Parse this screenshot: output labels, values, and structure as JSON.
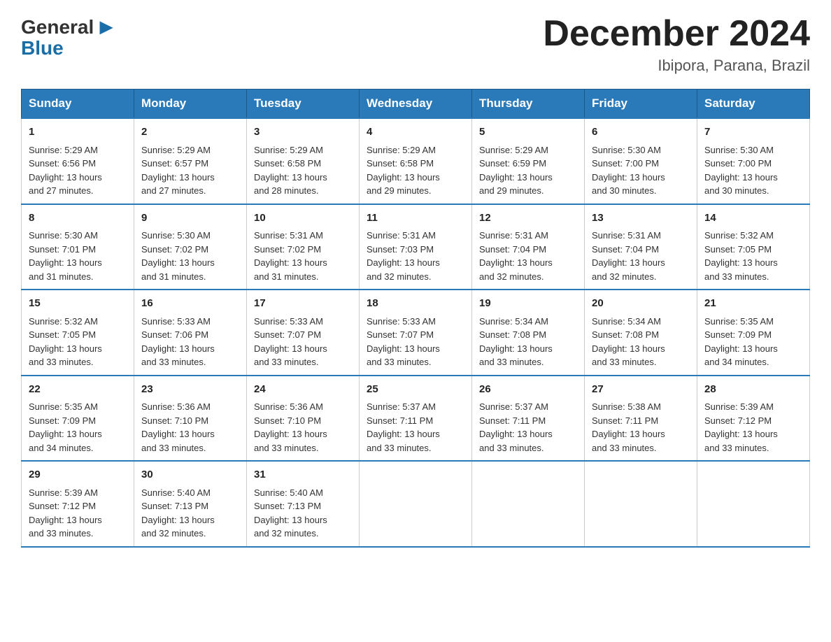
{
  "header": {
    "logo": {
      "general": "General",
      "blue": "Blue"
    },
    "title": "December 2024",
    "location": "Ibipora, Parana, Brazil"
  },
  "days_of_week": [
    "Sunday",
    "Monday",
    "Tuesday",
    "Wednesday",
    "Thursday",
    "Friday",
    "Saturday"
  ],
  "weeks": [
    [
      {
        "day": "1",
        "sunrise": "5:29 AM",
        "sunset": "6:56 PM",
        "daylight": "13 hours and 27 minutes."
      },
      {
        "day": "2",
        "sunrise": "5:29 AM",
        "sunset": "6:57 PM",
        "daylight": "13 hours and 27 minutes."
      },
      {
        "day": "3",
        "sunrise": "5:29 AM",
        "sunset": "6:58 PM",
        "daylight": "13 hours and 28 minutes."
      },
      {
        "day": "4",
        "sunrise": "5:29 AM",
        "sunset": "6:58 PM",
        "daylight": "13 hours and 29 minutes."
      },
      {
        "day": "5",
        "sunrise": "5:29 AM",
        "sunset": "6:59 PM",
        "daylight": "13 hours and 29 minutes."
      },
      {
        "day": "6",
        "sunrise": "5:30 AM",
        "sunset": "7:00 PM",
        "daylight": "13 hours and 30 minutes."
      },
      {
        "day": "7",
        "sunrise": "5:30 AM",
        "sunset": "7:00 PM",
        "daylight": "13 hours and 30 minutes."
      }
    ],
    [
      {
        "day": "8",
        "sunrise": "5:30 AM",
        "sunset": "7:01 PM",
        "daylight": "13 hours and 31 minutes."
      },
      {
        "day": "9",
        "sunrise": "5:30 AM",
        "sunset": "7:02 PM",
        "daylight": "13 hours and 31 minutes."
      },
      {
        "day": "10",
        "sunrise": "5:31 AM",
        "sunset": "7:02 PM",
        "daylight": "13 hours and 31 minutes."
      },
      {
        "day": "11",
        "sunrise": "5:31 AM",
        "sunset": "7:03 PM",
        "daylight": "13 hours and 32 minutes."
      },
      {
        "day": "12",
        "sunrise": "5:31 AM",
        "sunset": "7:04 PM",
        "daylight": "13 hours and 32 minutes."
      },
      {
        "day": "13",
        "sunrise": "5:31 AM",
        "sunset": "7:04 PM",
        "daylight": "13 hours and 32 minutes."
      },
      {
        "day": "14",
        "sunrise": "5:32 AM",
        "sunset": "7:05 PM",
        "daylight": "13 hours and 33 minutes."
      }
    ],
    [
      {
        "day": "15",
        "sunrise": "5:32 AM",
        "sunset": "7:05 PM",
        "daylight": "13 hours and 33 minutes."
      },
      {
        "day": "16",
        "sunrise": "5:33 AM",
        "sunset": "7:06 PM",
        "daylight": "13 hours and 33 minutes."
      },
      {
        "day": "17",
        "sunrise": "5:33 AM",
        "sunset": "7:07 PM",
        "daylight": "13 hours and 33 minutes."
      },
      {
        "day": "18",
        "sunrise": "5:33 AM",
        "sunset": "7:07 PM",
        "daylight": "13 hours and 33 minutes."
      },
      {
        "day": "19",
        "sunrise": "5:34 AM",
        "sunset": "7:08 PM",
        "daylight": "13 hours and 33 minutes."
      },
      {
        "day": "20",
        "sunrise": "5:34 AM",
        "sunset": "7:08 PM",
        "daylight": "13 hours and 33 minutes."
      },
      {
        "day": "21",
        "sunrise": "5:35 AM",
        "sunset": "7:09 PM",
        "daylight": "13 hours and 34 minutes."
      }
    ],
    [
      {
        "day": "22",
        "sunrise": "5:35 AM",
        "sunset": "7:09 PM",
        "daylight": "13 hours and 34 minutes."
      },
      {
        "day": "23",
        "sunrise": "5:36 AM",
        "sunset": "7:10 PM",
        "daylight": "13 hours and 33 minutes."
      },
      {
        "day": "24",
        "sunrise": "5:36 AM",
        "sunset": "7:10 PM",
        "daylight": "13 hours and 33 minutes."
      },
      {
        "day": "25",
        "sunrise": "5:37 AM",
        "sunset": "7:11 PM",
        "daylight": "13 hours and 33 minutes."
      },
      {
        "day": "26",
        "sunrise": "5:37 AM",
        "sunset": "7:11 PM",
        "daylight": "13 hours and 33 minutes."
      },
      {
        "day": "27",
        "sunrise": "5:38 AM",
        "sunset": "7:11 PM",
        "daylight": "13 hours and 33 minutes."
      },
      {
        "day": "28",
        "sunrise": "5:39 AM",
        "sunset": "7:12 PM",
        "daylight": "13 hours and 33 minutes."
      }
    ],
    [
      {
        "day": "29",
        "sunrise": "5:39 AM",
        "sunset": "7:12 PM",
        "daylight": "13 hours and 33 minutes."
      },
      {
        "day": "30",
        "sunrise": "5:40 AM",
        "sunset": "7:13 PM",
        "daylight": "13 hours and 32 minutes."
      },
      {
        "day": "31",
        "sunrise": "5:40 AM",
        "sunset": "7:13 PM",
        "daylight": "13 hours and 32 minutes."
      },
      null,
      null,
      null,
      null
    ]
  ],
  "labels": {
    "sunrise": "Sunrise:",
    "sunset": "Sunset:",
    "daylight": "Daylight:"
  }
}
